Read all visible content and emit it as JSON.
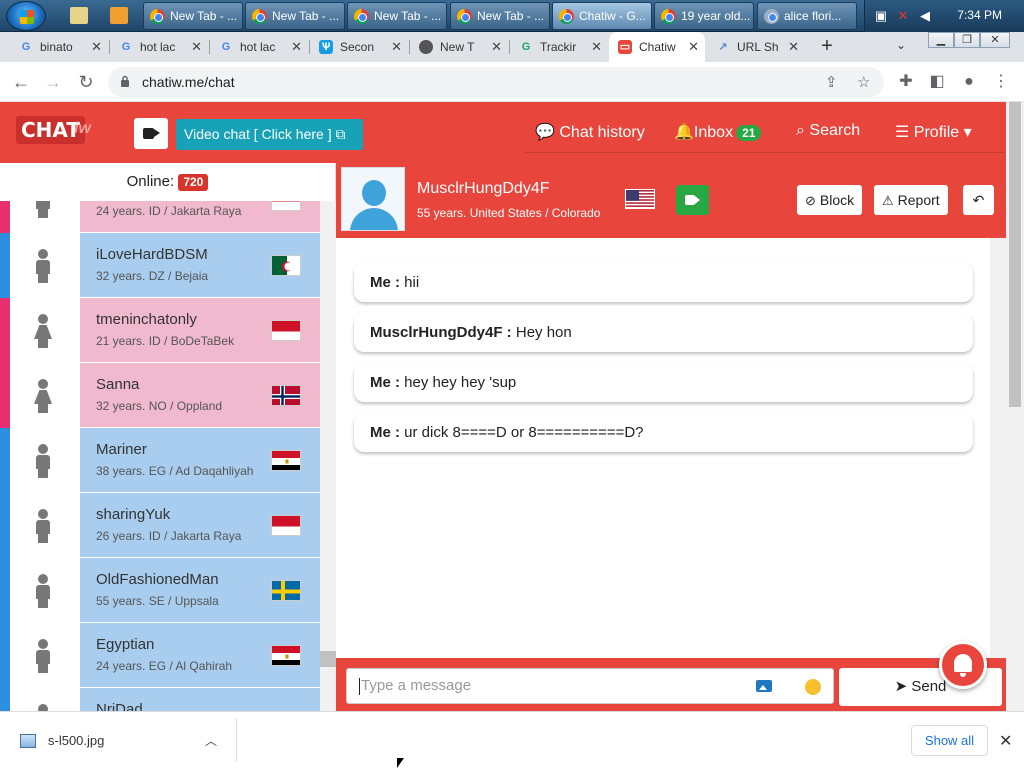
{
  "taskbar": {
    "tasks": [
      "New Tab - ...",
      "New Tab - ...",
      "New Tab - ...",
      "New Tab - ...",
      "Chatiw - G...",
      "19 year old...",
      "alice flori..."
    ],
    "clock": "7:34 PM"
  },
  "tabs": [
    "binato",
    "hot lac",
    "hot lac",
    "Secon",
    "New T",
    "Trackir",
    "Chatiw",
    "URL Sh"
  ],
  "address": {
    "url": "chatiw.me/chat"
  },
  "header": {
    "logo": "CHAT",
    "logo_tail": "iw",
    "video_chat": "Video chat  [ Click here ]",
    "chat_history": "Chat history",
    "inbox": "Inbox",
    "inbox_count": "21",
    "search": "Search",
    "profile": "Profile"
  },
  "online": {
    "label": "Online:",
    "count": "720"
  },
  "users": [
    {
      "name": "",
      "info": "24 years. ID / Jakarta Raya",
      "gender": "m",
      "flag": "id",
      "color": "pink"
    },
    {
      "name": "iLoveHardBDSM",
      "info": "32 years. DZ / Bejaia",
      "gender": "m",
      "flag": "dz",
      "color": "blue"
    },
    {
      "name": "tmeninchatonly",
      "info": "21 years. ID / BoDeTaBek",
      "gender": "f",
      "flag": "id",
      "color": "pink"
    },
    {
      "name": "Sanna",
      "info": "32 years. NO / Oppland",
      "gender": "f",
      "flag": "no",
      "color": "pink"
    },
    {
      "name": "Mariner",
      "info": "38 years. EG / Ad Daqahliyah",
      "gender": "m",
      "flag": "eg",
      "color": "blue"
    },
    {
      "name": "sharingYuk",
      "info": "26 years. ID / Jakarta Raya",
      "gender": "m",
      "flag": "id",
      "color": "blue"
    },
    {
      "name": "OldFashionedMan",
      "info": "55 years. SE / Uppsala",
      "gender": "m",
      "flag": "se",
      "color": "blue"
    },
    {
      "name": "Egyptian",
      "info": "24 years. EG / Al Qahirah",
      "gender": "m",
      "flag": "eg",
      "color": "blue"
    },
    {
      "name": "NriDad",
      "info": "",
      "gender": "m",
      "flag": "",
      "color": "blue"
    }
  ],
  "peer": {
    "name": "MusclrHungDdy4F",
    "info": "55 years. United States / Colorado",
    "block": "Block",
    "report": "Report"
  },
  "messages": [
    {
      "sender": "Me :",
      "text": " hii"
    },
    {
      "sender": "MusclrHungDdy4F :",
      "text": " Hey hon"
    },
    {
      "sender": "Me :",
      "text": " hey hey hey 'sup"
    },
    {
      "sender": "Me :",
      "text": " ur dick 8====D or 8==========D?"
    }
  ],
  "compose": {
    "placeholder": "Type a message",
    "send": "Send"
  },
  "downloads": {
    "file": "s-l500.jpg",
    "show_all": "Show all"
  },
  "colors": {
    "brand_red": "#e8453c",
    "teal": "#17a2b8",
    "male_blue": "#a9cdee",
    "female_pink": "#f0b9cd",
    "stripe_blue": "#2d8fe0",
    "stripe_pink": "#e8306e"
  }
}
